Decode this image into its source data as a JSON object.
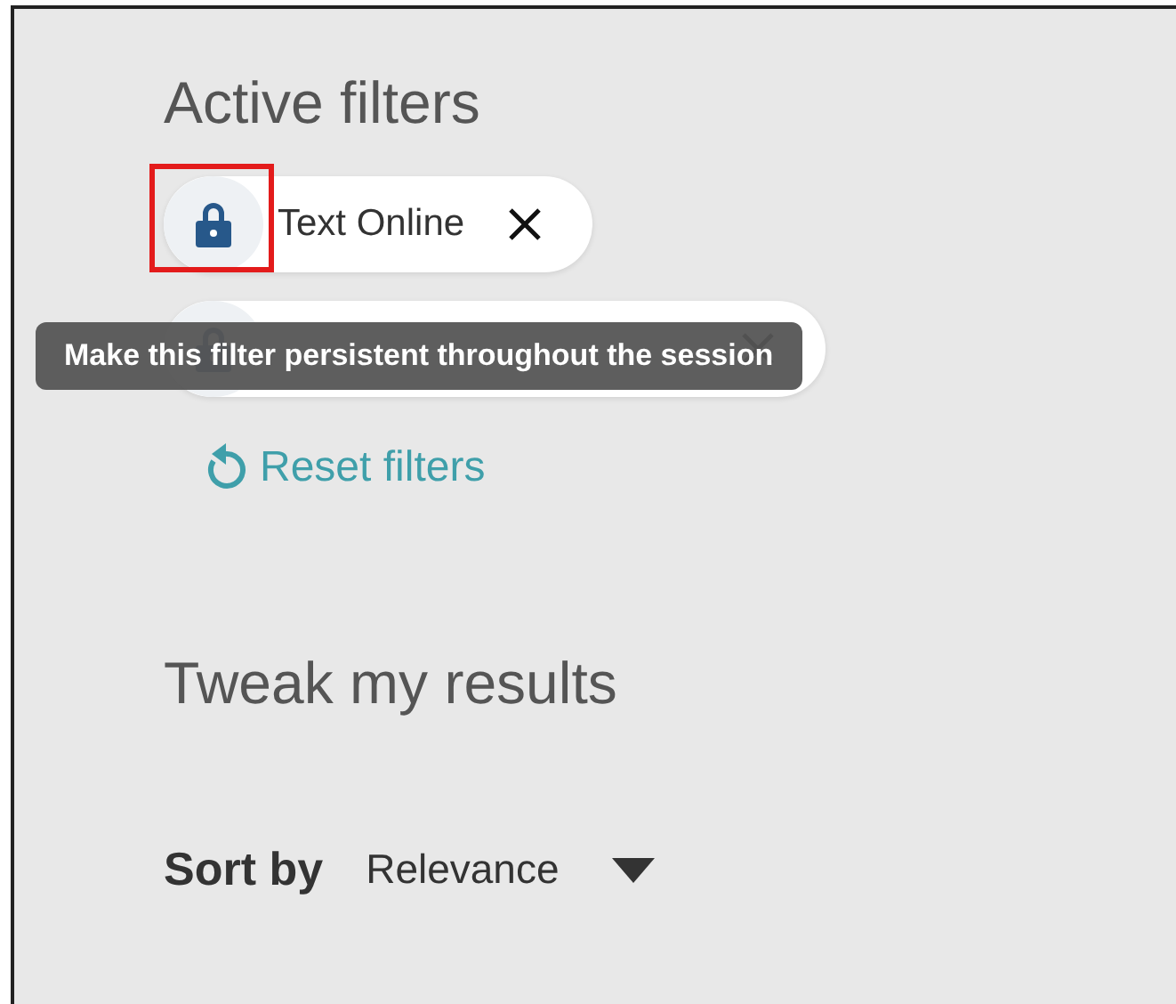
{
  "active_filters": {
    "title": "Active filters",
    "chips": [
      {
        "label": "Text Online",
        "highlighted": true
      },
      {
        "highlighted": false
      }
    ],
    "tooltip": "Make this filter persistent throughout the session",
    "reset": "Reset filters"
  },
  "tweak": {
    "title": "Tweak my results",
    "sort_label": "Sort by",
    "sort_value": "Relevance"
  }
}
